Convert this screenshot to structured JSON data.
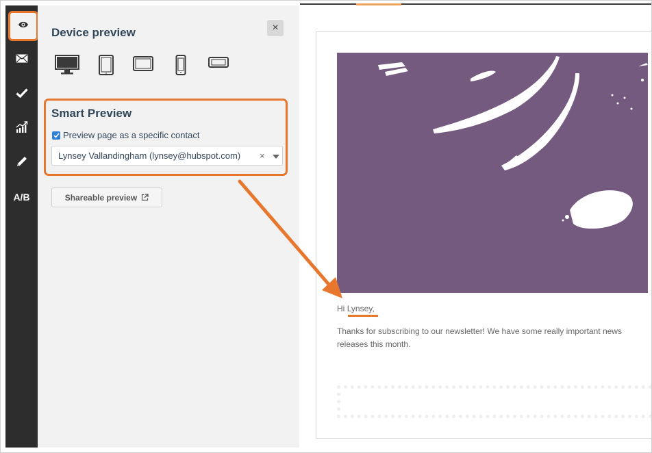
{
  "rail": {
    "items": [
      {
        "name": "preview",
        "icon": "eye-icon"
      },
      {
        "name": "email",
        "icon": "envelope-icon"
      },
      {
        "name": "checklist",
        "icon": "checkmark-icon"
      },
      {
        "name": "analytics",
        "icon": "chart-icon"
      },
      {
        "name": "edit",
        "icon": "pencil-icon"
      },
      {
        "name": "ab-test",
        "label": "A/B"
      }
    ]
  },
  "panel": {
    "title": "Device preview",
    "close_label": "×",
    "devices": [
      "desktop-icon",
      "tablet-portrait-icon",
      "tablet-landscape-icon",
      "phone-portrait-icon",
      "phone-landscape-icon"
    ],
    "smart_preview": {
      "title": "Smart Preview",
      "checkbox_label": "Preview page as a specific contact",
      "checked": true,
      "selected_contact": "Lynsey Vallandingham (lynsey@hubspot.com)",
      "clear_label": "×"
    },
    "share_button": "Shareable preview"
  },
  "email": {
    "greeting_prefix": "Hi",
    "greeting_name": "Lynsey",
    "greeting_suffix": ",",
    "body": "Thanks for subscribing to our newsletter! We have some really important news releases this month."
  },
  "colors": {
    "accent": "#e8772e",
    "hero": "#755a80",
    "rail": "#2d2d2d",
    "checkbox": "#2f7fd5"
  }
}
